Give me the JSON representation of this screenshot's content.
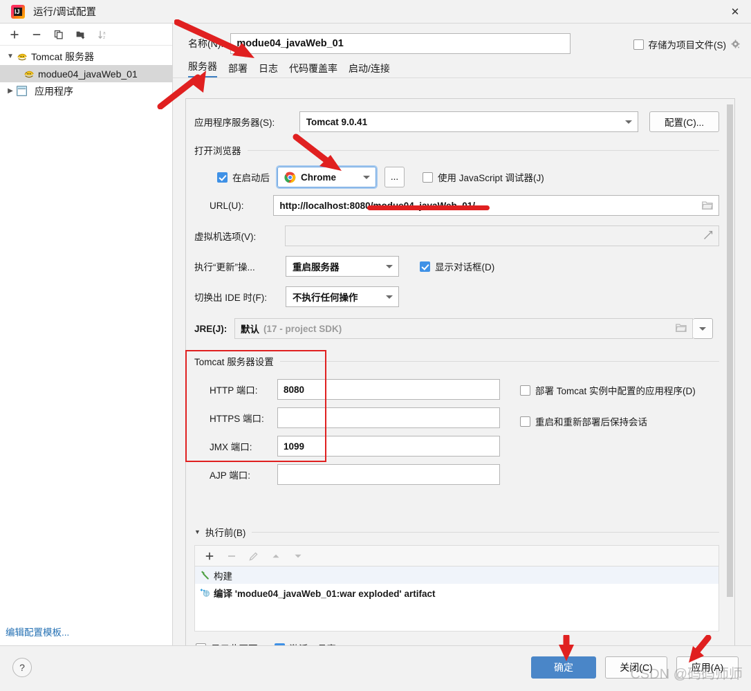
{
  "window": {
    "title": "运行/调试配置",
    "close_icon": "close-icon",
    "app_icon_text": "IJ"
  },
  "sidebar": {
    "toolbar": [
      {
        "name": "add-configuration-button",
        "icon": "plus-icon"
      },
      {
        "name": "remove-configuration-button",
        "icon": "minus-icon"
      },
      {
        "name": "copy-configuration-button",
        "icon": "copy-icon"
      },
      {
        "name": "new-folder-button",
        "icon": "folder-plus-icon"
      },
      {
        "name": "sort-configurations-button",
        "icon": "sort-alpha-icon"
      }
    ],
    "tree": [
      {
        "label": "Tomcat 服务器",
        "icon": "tomcat-icon",
        "twisty": "▼",
        "level": 0,
        "selected": false
      },
      {
        "label": "modue04_javaWeb_01",
        "icon": "tomcat-icon",
        "twisty": "",
        "level": 1,
        "selected": true
      },
      {
        "label": "应用程序",
        "icon": "application-group-icon",
        "twisty": "▶",
        "level": 0,
        "selected": false
      }
    ],
    "edit_templates_link": "编辑配置模板..."
  },
  "main": {
    "name_label": "名称(N):",
    "name_value": "modue04_javaWeb_01",
    "store_as_project_file": {
      "label": "存储为项目文件(S)",
      "checked": false,
      "gear_icon": "gear-icon"
    },
    "tabs": [
      {
        "label": "服务器",
        "active": true
      },
      {
        "label": "部署",
        "active": false
      },
      {
        "label": "日志",
        "active": false
      },
      {
        "label": "代码覆盖率",
        "active": false
      },
      {
        "label": "启动/连接",
        "active": false
      }
    ],
    "app_server": {
      "label": "应用程序服务器(S):",
      "value": "Tomcat 9.0.41",
      "configure_button": "配置(C)..."
    },
    "open_browser": {
      "group_title": "打开浏览器",
      "after_launch_label": "在启动后",
      "after_launch_checked": true,
      "browser_value": "Chrome",
      "browser_icon": "chrome-icon",
      "browse_button": "...",
      "js_debugger_label": "使用 JavaScript 调试器(J)",
      "js_debugger_checked": false,
      "url_label": "URL(U):",
      "url_value": "http://localhost:8080/modue04_javaWeb_01/",
      "url_browse_icon": "folder-icon"
    },
    "vm_options": {
      "label": "虚拟机选项(V):",
      "value": "",
      "expand_icon": "expand-icon"
    },
    "on_update": {
      "label": "执行“更新”操...",
      "value": "重启服务器",
      "show_dialog_label": "显示对话框(D)",
      "show_dialog_checked": true
    },
    "on_frame_deactivation": {
      "label": "切换出 IDE 时(F):",
      "value": "不执行任何操作"
    },
    "jre": {
      "label": "JRE(J):",
      "value": "默认",
      "hint": "(17 - project SDK)",
      "folder_icon": "folder-icon",
      "dropdown_icon": "chevron-down-icon"
    },
    "tomcat_settings": {
      "group_title": "Tomcat 服务器设置",
      "ports": [
        {
          "label": "HTTP 端口:",
          "value": "8080"
        },
        {
          "label": "HTTPS 端口:",
          "value": ""
        },
        {
          "label": "JMX 端口:",
          "value": "1099"
        },
        {
          "label": "AJP 端口:",
          "value": ""
        }
      ],
      "deploy_apps_label": "部署 Tomcat 实例中配置的应用程序(D)",
      "deploy_apps_checked": false,
      "preserve_sessions_label": "重启和重新部署后保持会话",
      "preserve_sessions_checked": false
    },
    "before_launch": {
      "group_title": "执行前(B)",
      "toolbar": [
        {
          "name": "add-task-button",
          "icon": "plus-icon",
          "enabled": true
        },
        {
          "name": "remove-task-button",
          "icon": "minus-icon",
          "enabled": false
        },
        {
          "name": "edit-task-button",
          "icon": "pencil-icon",
          "enabled": false
        },
        {
          "name": "move-up-button",
          "icon": "arrow-up-icon",
          "enabled": false
        },
        {
          "name": "move-down-button",
          "icon": "arrow-down-icon",
          "enabled": false
        }
      ],
      "items": [
        {
          "label": "构建",
          "icon": "hammer-icon",
          "selected": true
        },
        {
          "label": "编译 'modue04_javaWeb_01:war exploded' artifact",
          "icon": "artifact-icon",
          "selected": false
        }
      ],
      "show_page_label": "显示此页面",
      "show_page_checked": false,
      "activate_tool_window_label": "激活工具窗口",
      "activate_tool_window_checked": true
    }
  },
  "footer": {
    "help_label": "?",
    "ok_button": "确定",
    "close_button": "关闭(C)",
    "apply_button": "应用(A)"
  },
  "watermark": "CSDN @码码师师",
  "colors": {
    "accent": "#3d7ec1",
    "primary_button": "#4a86c8",
    "checkbox_checked": "#3f91e6",
    "annotation_red": "#e02020",
    "link": "#2470b3"
  }
}
